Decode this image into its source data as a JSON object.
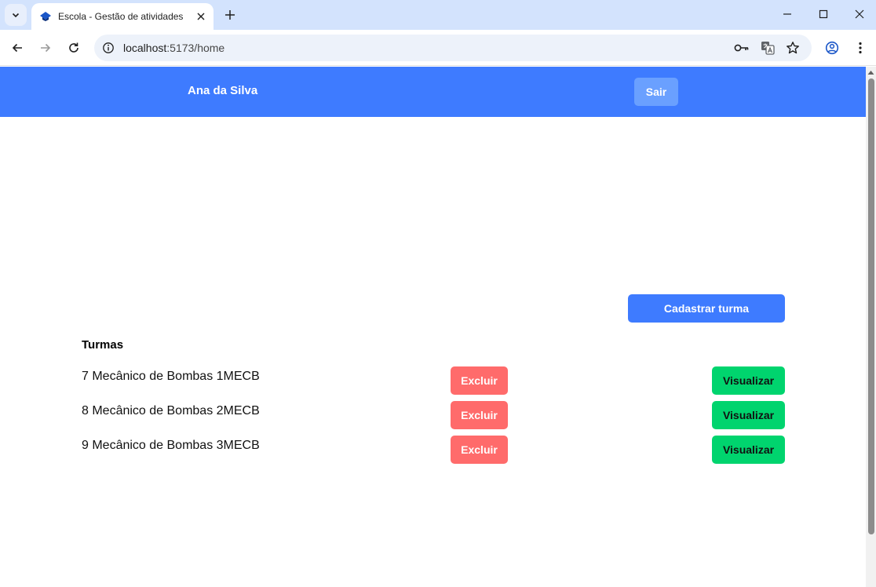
{
  "browser": {
    "tab_title": "Escola - Gestão de atividades",
    "url_host": "localhost",
    "url_path": ":5173/home"
  },
  "header": {
    "user_name": "Ana da Silva",
    "logout_label": "Sair"
  },
  "main": {
    "register_label": "Cadastrar turma",
    "list_title": "Turmas",
    "classes": [
      {
        "name": "7 Mecânico de Bombas 1MECB",
        "delete_label": "Excluir",
        "view_label": "Visualizar"
      },
      {
        "name": "8 Mecânico de Bombas 2MECB",
        "delete_label": "Excluir",
        "view_label": "Visualizar"
      },
      {
        "name": "9 Mecânico de Bombas 3MECB",
        "delete_label": "Excluir",
        "view_label": "Visualizar"
      }
    ]
  },
  "colors": {
    "header_bg": "#3e7bff",
    "logout_bg": "#6aa0ff",
    "delete_bg": "#ff6b6b",
    "view_bg": "#00d46e",
    "browser_tabbar": "#d3e3fd"
  },
  "icons": [
    "tab-search-icon",
    "favicon-icon",
    "close-icon",
    "plus-icon",
    "minimize-icon",
    "maximize-icon",
    "window-close-icon",
    "back-icon",
    "forward-icon",
    "reload-icon",
    "site-info-icon",
    "key-icon",
    "translate-icon",
    "star-icon",
    "profile-icon",
    "menu-icon"
  ]
}
